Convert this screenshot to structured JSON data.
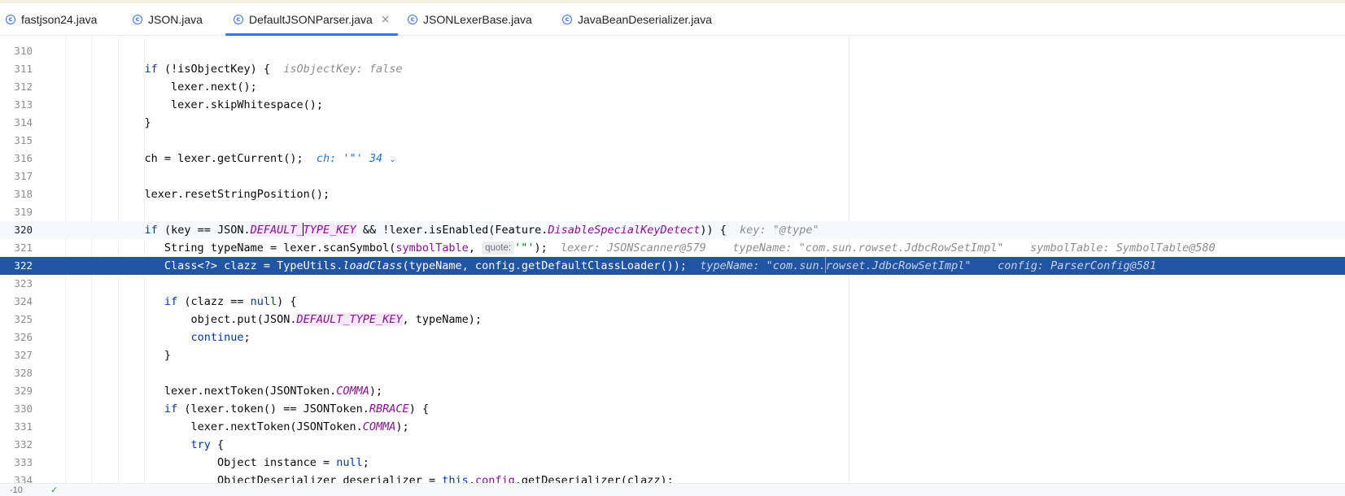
{
  "tabs": [
    {
      "label": "fastjson24.java",
      "active": false
    },
    {
      "label": "JSON.java",
      "active": false
    },
    {
      "label": "DefaultJSONParser.java",
      "active": true
    },
    {
      "label": "JSONLexerBase.java",
      "active": false
    },
    {
      "label": "JavaBeanDeserializer.java",
      "active": false
    }
  ],
  "tab_icon_letter": "c",
  "close_glyph": "×",
  "line_numbers": [
    "310",
    "311",
    "312",
    "313",
    "314",
    "315",
    "316",
    "317",
    "318",
    "319",
    "320",
    "321",
    "322",
    "323",
    "324",
    "325",
    "326",
    "327",
    "328",
    "329",
    "330",
    "331",
    "332",
    "333",
    "334"
  ],
  "current_line": "320",
  "selected_line": "322",
  "code": {
    "l311": {
      "kw_if": "if",
      "text": "(!isObjectKey) {",
      "hint": "isObjectKey: false"
    },
    "l312": {
      "text": "lexer.next();"
    },
    "l313": {
      "text": "lexer.skipWhitespace();"
    },
    "l314": {
      "text": "}"
    },
    "l316": {
      "text": "ch = lexer.getCurrent();",
      "hint": "ch: '\"' 34"
    },
    "l318": {
      "text": "lexer.resetStringPosition();"
    },
    "l320": {
      "kw_if": "if",
      "a": "(key == JSON.",
      "f1": "DEFAULT_",
      "f2": "TYPE_KEY",
      "b": " && !lexer.isEnabled(Feature.",
      "f3": "DisableSpecialKeyDetect",
      "c": ")) {",
      "hint": "key: \"@type\""
    },
    "l321": {
      "a": "String typeName = lexer.scanSymbol(",
      "p": "symbolTable",
      "b": ",",
      "pill": "quote:",
      "s": "'\"'",
      "c": ");",
      "hint1": "lexer: JSONScanner@579",
      "hint2": "typeName: \"com.sun.rowset.JdbcRowSetImpl\"",
      "hint3": "symbolTable: SymbolTable@580"
    },
    "l322": {
      "a": "Class<?> clazz = TypeUtils.",
      "m": "loadClass",
      "b": "(typeName, config.getDefaultClassLoader());",
      "hint1a": "typeName: \"com.sun.",
      "hint1b": "rowset.JdbcRowSetImpl\"",
      "hint2": "config: ParserConfig@581"
    },
    "l324": {
      "kw_if": "if",
      "a": "(clazz == ",
      "kw_null": "null",
      "b": ") {"
    },
    "l325": {
      "a": "object.put(JSON.",
      "f": "DEFAULT_TYPE_KEY",
      "b": ", typeName);"
    },
    "l326": {
      "kw": "continue",
      "b": ";"
    },
    "l327": {
      "text": "}"
    },
    "l329": {
      "a": "lexer.nextToken(JSONToken.",
      "f": "COMMA",
      "b": ");"
    },
    "l330": {
      "kw_if": "if",
      "a": "(lexer.token() == JSONToken.",
      "f": "RBRACE",
      "b": ") {"
    },
    "l331": {
      "a": "lexer.nextToken(JSONToken.",
      "f": "COMMA",
      "b": ");"
    },
    "l332": {
      "kw": "try",
      "b": "{"
    },
    "l333": {
      "a": "Object instance = ",
      "kw_null": "null",
      "b": ";"
    },
    "l334": {
      "a": "ObjectDeserializer deserializer = ",
      "kw_this": "this",
      "dot": ".",
      "f": "config",
      "b": ".getDeserializer(clazz);"
    }
  },
  "chevron_glyph": "⌄",
  "status": {
    "left": "-10",
    "right": "✓"
  }
}
